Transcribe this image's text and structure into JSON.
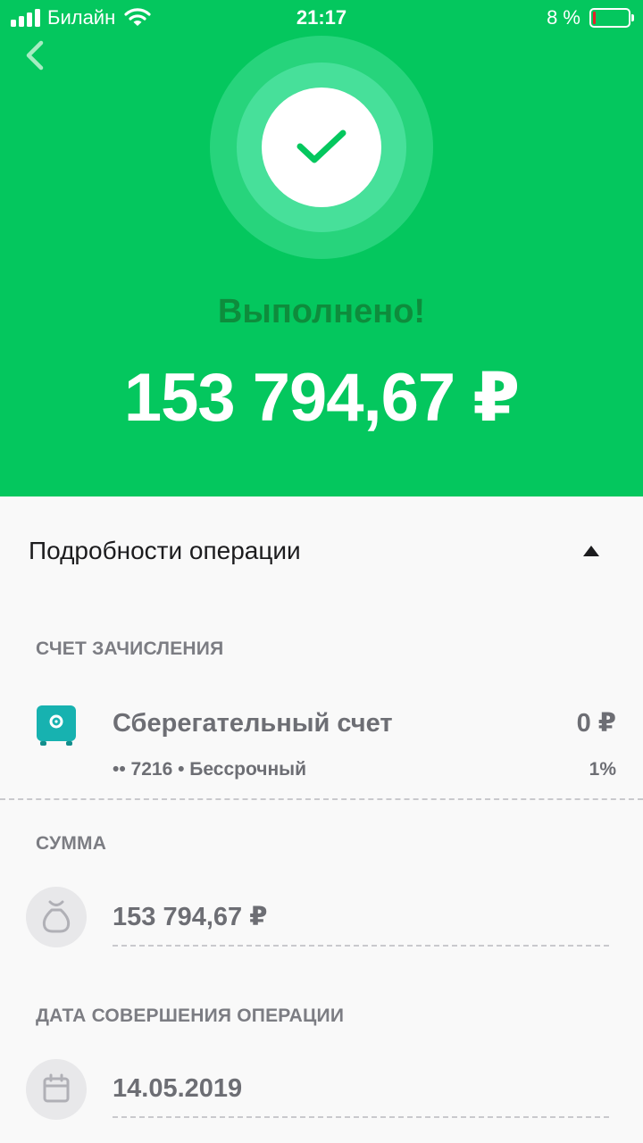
{
  "status_bar": {
    "carrier": "Билайн",
    "time": "21:17",
    "battery_percent": "8 %",
    "battery_level": 0.08,
    "battery_color": "#e8202a"
  },
  "header": {
    "back_icon": "chevron-left-icon",
    "status_icon": "checkmark-icon",
    "status_title": "Выполнено!",
    "amount": "153 794,67 ₽",
    "background_color": "#04c75e"
  },
  "details": {
    "title": "Подробности операции",
    "toggle_icon": "triangle-up-icon",
    "account_section": {
      "label": "СЧЕТ ЗАЧИСЛЕНИЯ",
      "icon": "safe-icon",
      "icon_color": "#17b2b0",
      "name": "Сберегательный счет",
      "balance": "0 ₽",
      "sub": "•• 7216 • Бессрочный",
      "rate": "1%"
    },
    "amount_section": {
      "label": "СУММА",
      "icon": "money-bag-icon",
      "value": "153 794,67 ₽"
    },
    "date_section": {
      "label": "ДАТА СОВЕРШЕНИЯ ОПЕРАЦИИ",
      "icon": "calendar-icon",
      "value": "14.05.2019"
    }
  }
}
